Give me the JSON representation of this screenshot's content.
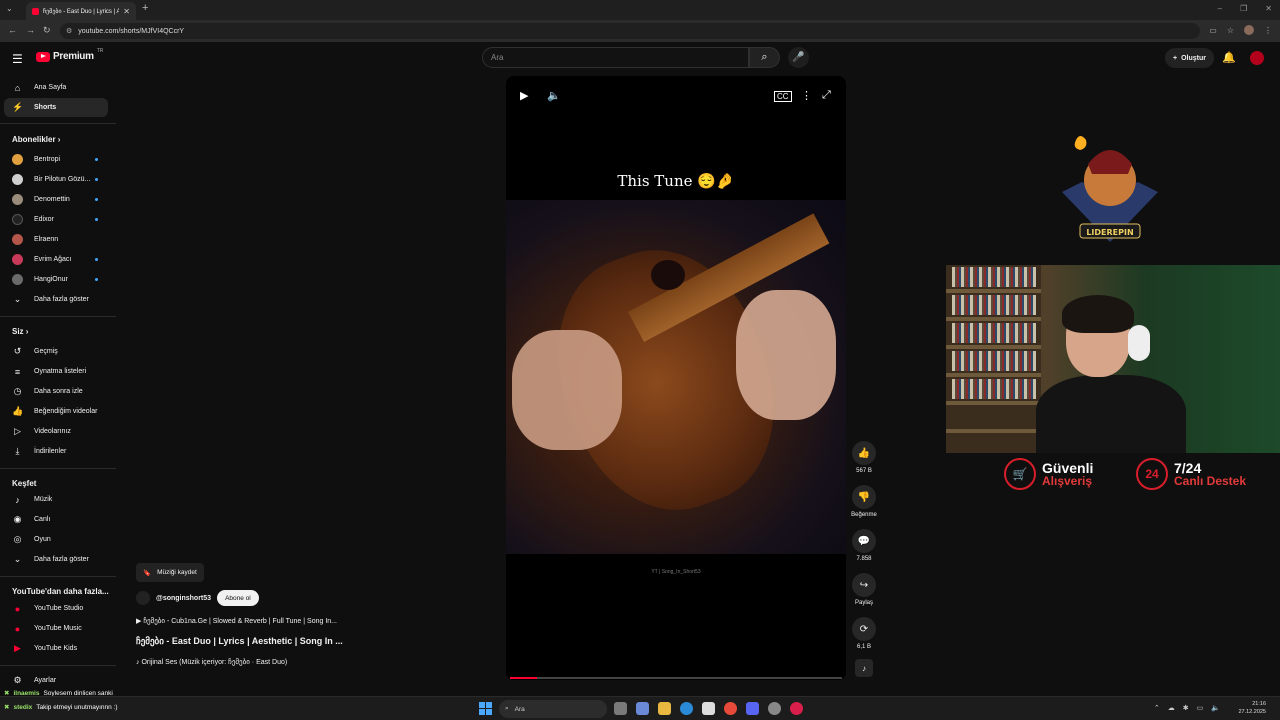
{
  "browser": {
    "tab_title": "ჩემები - East Duo | Lyrics | Ae...",
    "url": "youtube.com/shorts/MJfVI4QCcrY"
  },
  "header": {
    "brand": "Premium",
    "brand_region": "TR",
    "search_placeholder": "Ara",
    "create_label": "Oluştur"
  },
  "sidebar": {
    "top": [
      {
        "label": "Ana Sayfa",
        "icon": "⌂"
      },
      {
        "label": "Shorts",
        "icon": "⚡"
      }
    ],
    "subs_heading": "Abonelikler",
    "subs": [
      {
        "label": "Bentropi",
        "color": "#e0a040"
      },
      {
        "label": "Bir Pilotun Gözü...",
        "color": "#cfcfcf"
      },
      {
        "label": "Denomettin",
        "color": "#9a8c7a"
      },
      {
        "label": "Edixor",
        "color": "#222222"
      },
      {
        "label": "Elraenn",
        "color": "#b4564a"
      },
      {
        "label": "Evrim Ağacı",
        "color": "#c83a5a"
      },
      {
        "label": "HangiOnur",
        "color": "#6a6a6a"
      }
    ],
    "subs_more": "Daha fazla göster",
    "you_heading": "Siz",
    "you": [
      {
        "label": "Geçmiş",
        "icon": "↺"
      },
      {
        "label": "Oynatma listeleri",
        "icon": "≡"
      },
      {
        "label": "Daha sonra izle",
        "icon": "◷"
      },
      {
        "label": "Beğendiğim videolar",
        "icon": "👍"
      },
      {
        "label": "Videolarınız",
        "icon": "▷"
      },
      {
        "label": "İndirilenler",
        "icon": "⤓"
      }
    ],
    "explore_heading": "Keşfet",
    "explore": [
      {
        "label": "Müzik",
        "icon": "♪"
      },
      {
        "label": "Canlı",
        "icon": "◉"
      },
      {
        "label": "Oyun",
        "icon": "◎"
      }
    ],
    "explore_more": "Daha fazla göster",
    "more_heading": "YouTube'dan daha fazla...",
    "more": [
      {
        "label": "YouTube Studio"
      },
      {
        "label": "YouTube Music"
      },
      {
        "label": "YouTube Kids"
      }
    ],
    "settings": "Ayarlar"
  },
  "video": {
    "overlay_text": "This Tune 😌🤌",
    "credit": "YT | Song_In_Short53",
    "progress": 0.08,
    "save_music": "Müziği kaydet",
    "channel": "@songinshort53",
    "subscribe": "Abone ol",
    "desc_line": "▶ ჩემები - Cub1na.Ge | Slowed & Reverb | Full Tune | Song In...",
    "title": "ჩემები - East Duo | Lyrics | Aesthetic | Song In ...",
    "audio": "♪ Orijinal Ses (Müzik içeriyor: ჩემები · East Duo)"
  },
  "actions": {
    "like_count": "567 B",
    "dislike_label": "Beğenme",
    "comments_count": "7.858",
    "share_label": "Paylaş",
    "remix_count": "6,1 B"
  },
  "stream": {
    "badge_text": "LIDEREPIN",
    "promo1_line1": "Güvenli",
    "promo1_line2": "Alışveriş",
    "promo2_badge": "24",
    "promo2_line1": "7/24",
    "promo2_line2": "Canlı Destek"
  },
  "chat": [
    {
      "name": "ilnaemis",
      "text": "Soylesem dinlicen sanki"
    },
    {
      "name": "stedix",
      "text": "Takip etmeyi unutmayınnn :)"
    }
  ],
  "taskbar": {
    "search": "Ara",
    "time": "21:16",
    "date": "27.12.2025"
  }
}
